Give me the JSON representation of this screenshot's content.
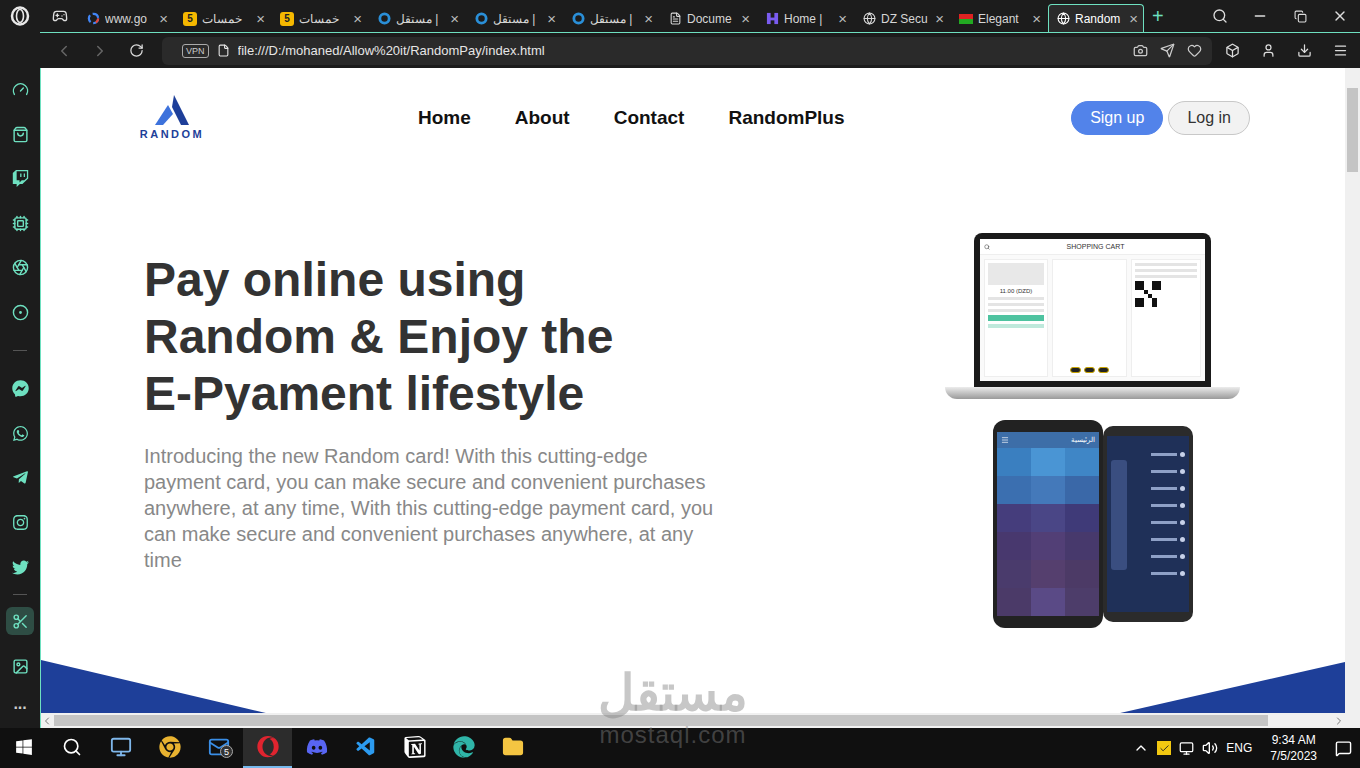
{
  "browser": {
    "tabs": [
      {
        "label": "www.go",
        "kind": "google",
        "selected": false
      },
      {
        "label": "خمسات",
        "kind": "khamsat",
        "badge": "5",
        "selected": false
      },
      {
        "label": "خمسات",
        "kind": "khamsat",
        "badge": "5",
        "selected": false
      },
      {
        "label": "مستقل |",
        "kind": "mostaql",
        "selected": false
      },
      {
        "label": "مستقل |",
        "kind": "mostaql",
        "selected": false
      },
      {
        "label": "مستقل |",
        "kind": "mostaql",
        "selected": false
      },
      {
        "label": "Docume",
        "kind": "doc",
        "selected": false
      },
      {
        "label": "Home |",
        "kind": "home",
        "selected": false
      },
      {
        "label": "DZ Secu",
        "kind": "globe",
        "selected": false
      },
      {
        "label": "Elegant",
        "kind": "flag",
        "selected": false
      },
      {
        "label": "Random",
        "kind": "globe",
        "selected": true
      }
    ],
    "tab_close": "×",
    "new_tab": "+",
    "address": {
      "vpn": "VPN",
      "url": "file:///D:/mohaned/Allow%20it/RandomPay/index.html"
    },
    "sidebar": {
      "items": [
        {
          "selected": false
        },
        {
          "selected": false
        },
        {
          "selected": false
        },
        {
          "selected": false
        },
        {
          "selected": false
        },
        {
          "selected": false
        },
        {
          "selected": false
        },
        {
          "selected": false
        },
        {
          "selected": false
        },
        {
          "selected": false
        },
        {
          "selected": false
        },
        {
          "selected": true
        },
        {
          "selected": false
        }
      ],
      "more": "···"
    }
  },
  "page": {
    "logo": "RANDOM",
    "nav": [
      {
        "label": "Home"
      },
      {
        "label": "About"
      },
      {
        "label": "Contact"
      },
      {
        "label": "RandomPlus"
      }
    ],
    "auth": [
      {
        "label": "Sign up",
        "kind": "primary"
      },
      {
        "label": "Log in",
        "kind": "secondary"
      }
    ],
    "hero": {
      "title": [
        "Pay online using",
        "Random & Enjoy the",
        "E-Pyament lifestyle"
      ],
      "text": "Introducing the new Random card! With this cutting-edge payment card, you can make secure and convenient purchases anywhere, at any time, With this cutting-edge payment card, you can make secure and convenient purchases anywhere, at any time"
    },
    "mockup": {
      "laptop_title": "SHOPPING CART",
      "laptop_price": "11.00 (DZD)",
      "phone_title": "الرئيسية"
    },
    "scrollbars": {
      "horizontal": {
        "level": 0.95
      },
      "vertical": {
        "level": 0.13
      }
    }
  },
  "taskbar": {
    "apps": [
      {
        "kind": "computer",
        "selected": false
      },
      {
        "kind": "chrome",
        "selected": false
      },
      {
        "kind": "mail",
        "badge": "5",
        "selected": false
      },
      {
        "kind": "opera",
        "selected": true
      },
      {
        "kind": "discord",
        "selected": false
      },
      {
        "kind": "vscode",
        "selected": false
      },
      {
        "kind": "notion",
        "selected": false
      },
      {
        "kind": "edge",
        "selected": false
      },
      {
        "kind": "folder",
        "selected": false
      }
    ],
    "tray": {
      "language": "ENG",
      "time": "9:34 AM",
      "date": "7/5/2023"
    }
  },
  "watermark": {
    "arabic": "مستقل",
    "latin": "mostaql.com"
  }
}
